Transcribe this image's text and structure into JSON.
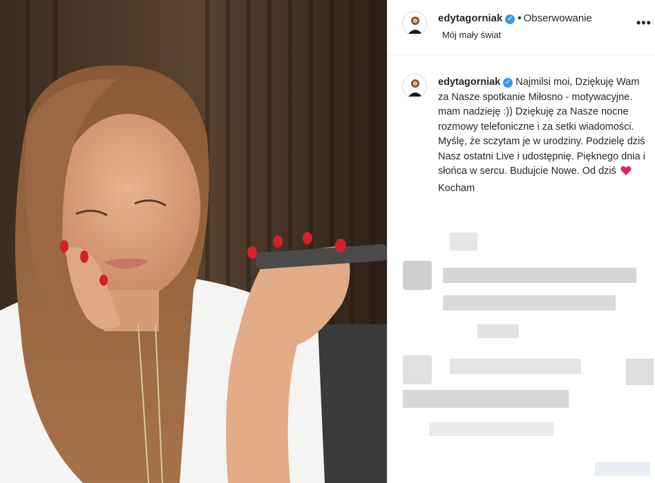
{
  "post": {
    "username": "edytagorniak",
    "verified_icon": "verified-badge-icon",
    "follow_separator": "•",
    "follow_label": "Obserwowanie",
    "location": "Mój mały świat",
    "more_icon": "more-options-icon",
    "more_glyph": "•••"
  },
  "caption": {
    "username": "edytagorniak",
    "text_part1": "Najmilsi moi, Dziękuję Wam za Nasze spotkanie Miłosno - motywacyjne. mam nadzieję :)) Dziękuję za Nasze nocne rozmowy telefoniczne i za setki wiadomości. Myślę, że sczytam je w urodziny. Podzielę dziś Nasz ostatni Live i udostępnię. Pięknego dnia i słońca w sercu. Budujcie Nowe. Od dziś",
    "text_part2": "Kocham",
    "emoji": "heart-icon"
  },
  "colors": {
    "verified": "#3897f0",
    "heart": "#e0245e",
    "text": "#262626",
    "divider": "#efefef"
  }
}
